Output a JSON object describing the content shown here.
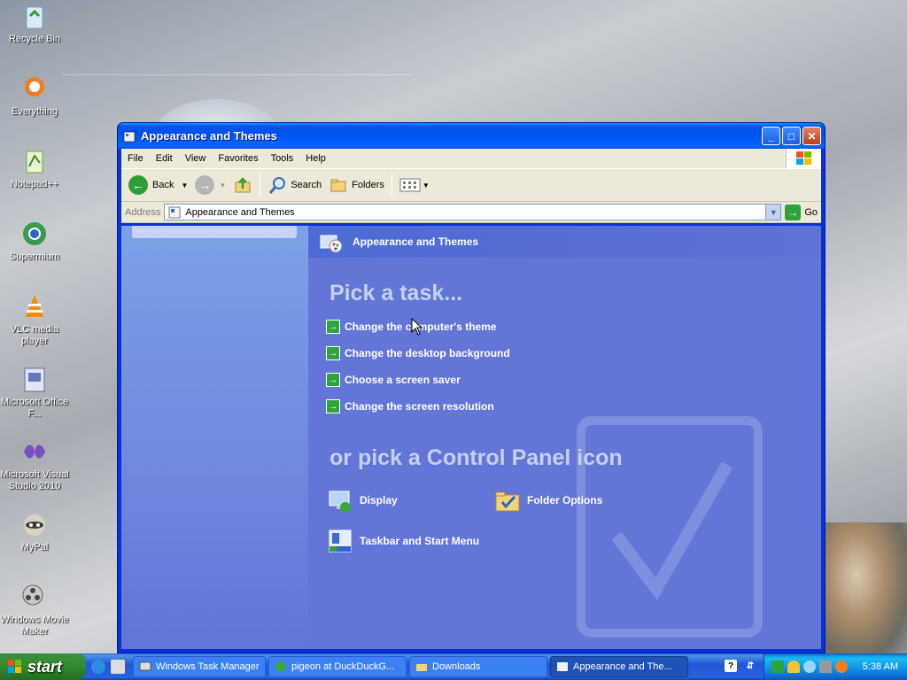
{
  "desktop": {
    "icons": [
      {
        "label": "Recycle Bin"
      },
      {
        "label": "Everything"
      },
      {
        "label": "Notepad++"
      },
      {
        "label": "Supermium"
      },
      {
        "label": "VLC media player"
      },
      {
        "label": "Microsoft Office F..."
      },
      {
        "label": "Microsoft Visual Studio 2010"
      },
      {
        "label": "MyPal"
      },
      {
        "label": "Windows Movie Maker"
      }
    ]
  },
  "window": {
    "title": "Appearance and Themes",
    "menu": [
      "File",
      "Edit",
      "View",
      "Favorites",
      "Tools",
      "Help"
    ],
    "toolbar": {
      "back_label": "Back",
      "search_label": "Search",
      "folders_label": "Folders"
    },
    "address": {
      "label": "Address",
      "value": "Appearance and Themes",
      "go_label": "Go"
    },
    "main": {
      "header_title": "Appearance and Themes",
      "pick_task_heading": "Pick a task...",
      "tasks": [
        "Change the computer's theme",
        "Change the desktop background",
        "Choose a screen saver",
        "Change the screen resolution"
      ],
      "pick_icon_heading": "or pick a Control Panel icon",
      "icons": [
        {
          "label": "Display"
        },
        {
          "label": "Folder Options"
        },
        {
          "label": "Taskbar and Start Menu"
        }
      ]
    }
  },
  "taskbar": {
    "start_label": "start",
    "buttons": [
      {
        "label": "Windows Task Manager"
      },
      {
        "label": "pigeon at DuckDuckG..."
      },
      {
        "label": "Downloads"
      },
      {
        "label": "Appearance and The..."
      }
    ],
    "clock": "5:38 AM"
  },
  "colors": {
    "window_frame": "#0831d9",
    "sidebar_bg": "#7ba2e7",
    "main_bg": "#6375d6",
    "start_green": "#2e8c2e",
    "task_arrow_green": "#2ea43c"
  }
}
